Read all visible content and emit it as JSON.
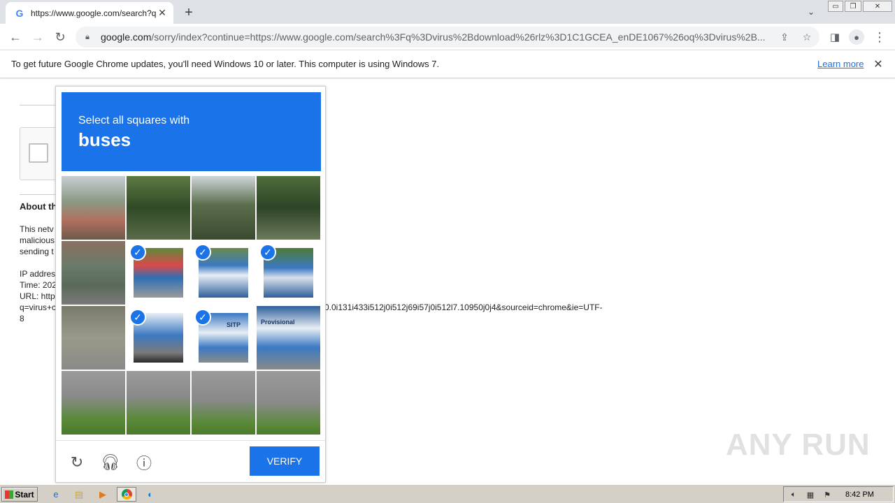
{
  "browser": {
    "tab_title": "https://www.google.com/search?q=",
    "tab_favicon": "G",
    "new_tab_symbol": "+",
    "url_domain": "google.com",
    "url_rest": "/sorry/index?continue=https://www.google.com/search%3Fq%3Dvirus%2Bdownload%26rlz%3D1C1GCEA_enDE1067%26oq%3Dvirus%2B...",
    "icons": [
      "back-icon",
      "forward-icon",
      "reload-icon",
      "lock-icon",
      "share-icon",
      "star-icon",
      "side-panel-icon",
      "profile-icon",
      "menu-icon"
    ]
  },
  "infobar": {
    "message": "To get future Google Chrome updates, you'll need Windows 10 or later. This computer is using Windows 7.",
    "learn_more": "Learn more"
  },
  "page": {
    "heading": "About th",
    "lines": [
      "This netv",
      "malicious",
      "sending t",
      "IP addres",
      "Time: 202",
      "URL: http"
    ],
    "url_line": "q=virus+c",
    "url_tail": "0.0i131i433i512j0i512j69i57j0i512l7.10950j0j4&sourceid=chrome&ie=UTF-",
    "url_end": "8"
  },
  "captcha": {
    "instruction": "Select all squares with",
    "object": "buses",
    "verify_label": "VERIFY",
    "tiles": [
      {
        "selected": false,
        "bg": "linear-gradient(180deg,#c9ced3 0%,#8a9a84 40%,#b07060 70%,#6b5a4a 100%)"
      },
      {
        "selected": false,
        "bg": "linear-gradient(180deg,#5d7a44 0%,#2f4a26 50%,#5a6b4a 100%)"
      },
      {
        "selected": false,
        "bg": "linear-gradient(180deg,#cfd6dc 0%,#5b6e4c 45%,#3a4a30 100%)"
      },
      {
        "selected": false,
        "bg": "linear-gradient(180deg,#4e6d3c 0%,#2d4426 50%,#6a7a5a 100%)"
      },
      {
        "selected": false,
        "bg": "linear-gradient(180deg,#8a7060 0%,#6a7a6a 40%,#5a6a5a 70%,#7a7a7a 100%)"
      },
      {
        "selected": true,
        "bg": "linear-gradient(180deg,#5d8a3a 0%,#d94a4a 35%,#2f6fb5 60%,#9a9a9a 100%)"
      },
      {
        "selected": true,
        "bg": "linear-gradient(180deg,#6a8a4a 0%,#3b79c2 35%,#e8eef5 55%,#2e5f9a 100%)"
      },
      {
        "selected": true,
        "bg": "linear-gradient(180deg,#4d7a34 0%,#3b79c2 40%,#d8e0ea 60%,#2e5f9a 100%)"
      },
      {
        "selected": false,
        "bg": "linear-gradient(180deg,#7a7a6a 0%,#9a9a8a 50%,#8a8a8a 100%)"
      },
      {
        "selected": true,
        "bg": "linear-gradient(180deg,#e8eef5 0%,#3b79c2 45%,#7a7a7a 80%,#2a2a2a 100%)"
      },
      {
        "selected": true,
        "bg": "linear-gradient(180deg,#3b79c2 0%,#e8eef5 40%,#3b79c2 70%,#8a8a8a 100%)"
      },
      {
        "selected": false,
        "bg": "linear-gradient(180deg,#2e5f9a 0%,#e8eef5 35%,#3b79c2 65%,#8a8a8a 100%)",
        "label": "Provisional"
      },
      {
        "selected": false,
        "bg": "linear-gradient(180deg,#9a9a9a 0%,#8a8a8a 40%,#5a8a3a 75%,#4a7a2a 100%)"
      },
      {
        "selected": false,
        "bg": "linear-gradient(180deg,#9a9a9a 0%,#8a8a8a 40%,#5a8a3a 75%,#4a7a2a 100%)"
      },
      {
        "selected": false,
        "bg": "linear-gradient(180deg,#9a9a9a 0%,#8a8a8a 45%,#5a8a3a 80%,#4a7a2a 100%)"
      },
      {
        "selected": false,
        "bg": "linear-gradient(180deg,#9a9a9a 0%,#8a8a8a 50%,#5a8a3a 85%,#4a7a2a 100%)"
      }
    ],
    "tile_label_bus": "SITP"
  },
  "watermark": "ANY RUN",
  "taskbar": {
    "start_label": "Start",
    "clock": "8:42 PM"
  },
  "colors": {
    "accent": "#1a73e8",
    "tabstrip": "#dee1e6",
    "taskbar": "#d4d0c8"
  }
}
